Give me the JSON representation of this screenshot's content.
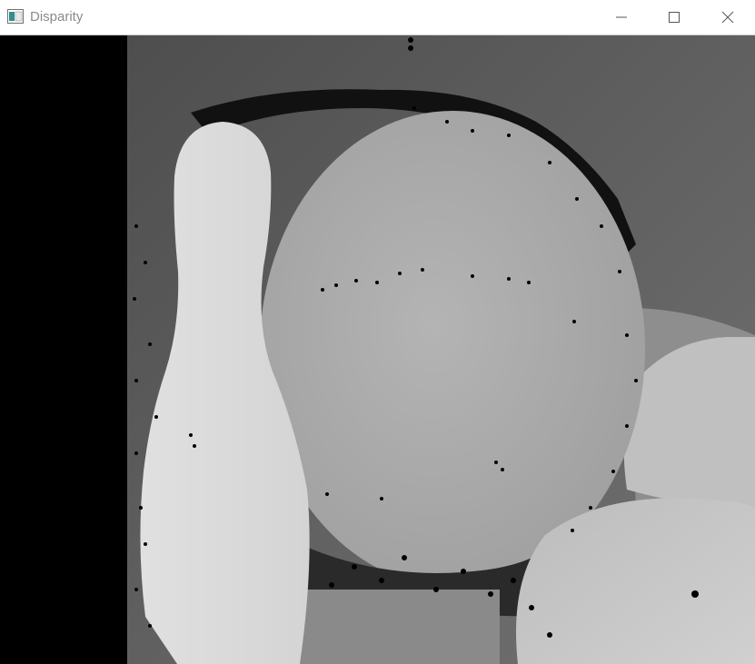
{
  "window": {
    "title": "Disparity",
    "icon": "opencv-window-icon",
    "controls": [
      "minimize-icon",
      "maximize-icon",
      "close-icon"
    ]
  },
  "image": {
    "content": "disparity-map",
    "colors": {
      "background": "#000000",
      "far_wall": "#5f5f5f",
      "ball": "#a9a9a9",
      "pin": "#dadada",
      "right_object": "#c6c6c6",
      "right_back": "#8c8c8c"
    }
  }
}
